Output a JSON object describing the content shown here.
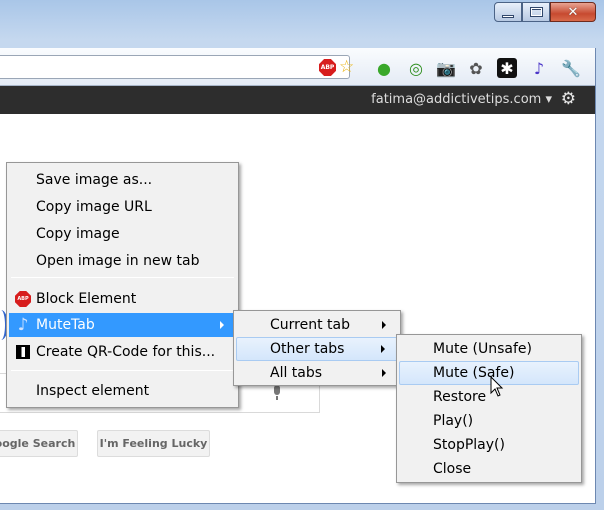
{
  "toolbar": {
    "extensions": [
      {
        "icon": "green-ball-icon",
        "glyph": "●",
        "color": "#3aa82a"
      },
      {
        "icon": "refresh-ring-icon",
        "glyph": "◎",
        "color": "#2f8f1f"
      },
      {
        "icon": "camera-icon",
        "glyph": "📷",
        "color": "#2d4f8f"
      },
      {
        "icon": "puzzle-icon",
        "glyph": "✿",
        "color": "#555555"
      },
      {
        "icon": "asterisk-icon",
        "glyph": "✱",
        "color": "#ffffff"
      },
      {
        "icon": "music-note-icon",
        "glyph": "♪",
        "color": "#4a35c8"
      },
      {
        "icon": "wrench-icon",
        "glyph": "🔧",
        "color": "#444444"
      }
    ],
    "abp_text": "ABP"
  },
  "google_bar": {
    "user": "fatima@addictivetips.com",
    "user_caret": "▾"
  },
  "page": {
    "button_search": "oogle Search",
    "button_lucky": "I'm Feeling Lucky"
  },
  "context_menu": {
    "items": [
      {
        "label": "Save image as..."
      },
      {
        "label": "Copy image URL"
      },
      {
        "label": "Copy image"
      },
      {
        "label": "Open image in new tab"
      },
      {
        "label": "Block Element",
        "icon": "adblock-icon"
      },
      {
        "label": "MuteTab",
        "icon": "music-note-icon",
        "submenu": true,
        "highlighted": true
      },
      {
        "label": "Create QR-Code for this...",
        "icon": "qr-code-icon"
      },
      {
        "label": "Inspect element"
      }
    ]
  },
  "mutetab_menu": {
    "items": [
      {
        "label": "Current tab",
        "submenu": true
      },
      {
        "label": "Other tabs",
        "submenu": true,
        "highlighted": true
      },
      {
        "label": "All tabs",
        "submenu": true
      }
    ]
  },
  "othertabs_menu": {
    "items": [
      {
        "label": "Mute (Unsafe)"
      },
      {
        "label": "Mute (Safe)",
        "highlighted": true
      },
      {
        "label": "Restore"
      },
      {
        "label": "Play()"
      },
      {
        "label": "StopPlay()"
      },
      {
        "label": "Close"
      }
    ]
  },
  "colors": {
    "menu_highlight": "#3399ff",
    "google_bar": "#2d2d2d",
    "abp_red": "#d71d1d"
  }
}
